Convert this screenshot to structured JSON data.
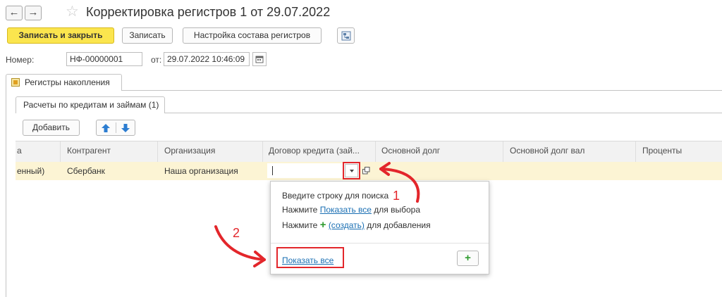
{
  "window": {
    "title": "Корректировка регистров 1 от 29.07.2022",
    "back_glyph": "←",
    "forward_glyph": "→",
    "favorite_glyph": "☆"
  },
  "toolbar": {
    "save_close_label": "Записать и закрыть",
    "save_label": "Записать",
    "registers_setup_label": "Настройка состава регистров"
  },
  "form": {
    "number_label": "Номер:",
    "number_value": "НФ-00000001",
    "date_label": "от:",
    "date_value": "29.07.2022 10:46:09"
  },
  "tabs": {
    "main_tab_label": "Регистры накопления",
    "sub_tab_label": "Расчеты по кредитам и займам (1)"
  },
  "table_toolbar": {
    "add_label": "Добавить",
    "up_glyph": "🡅",
    "down_glyph": "🡇"
  },
  "table": {
    "columns": [
      "а",
      "Контрагент",
      "Организация",
      "Договор кредита (зай...",
      "Основной долг",
      "Основной долг вал",
      "Проценты"
    ],
    "row": [
      "енный)",
      "Сбербанк",
      "Наша организация",
      "",
      "",
      "",
      ""
    ]
  },
  "popup": {
    "line1": "Введите строку для поиска",
    "line2_prefix": "Нажмите ",
    "line2_link": "Показать все",
    "line2_suffix": " для выбора",
    "line3_prefix": "Нажмите ",
    "line3_link": "(создать)",
    "line3_suffix": " для добавления",
    "show_all_label": "Показать все",
    "plus_glyph": "+"
  },
  "annotations": {
    "marker1": "1",
    "marker2": "2"
  },
  "colors": {
    "primary_button": "#fbe54e",
    "selected_row": "#fcf4d4",
    "annotation_red": "#e3262b",
    "link": "#1a6fb3",
    "plus_green": "#2e9b2e"
  }
}
